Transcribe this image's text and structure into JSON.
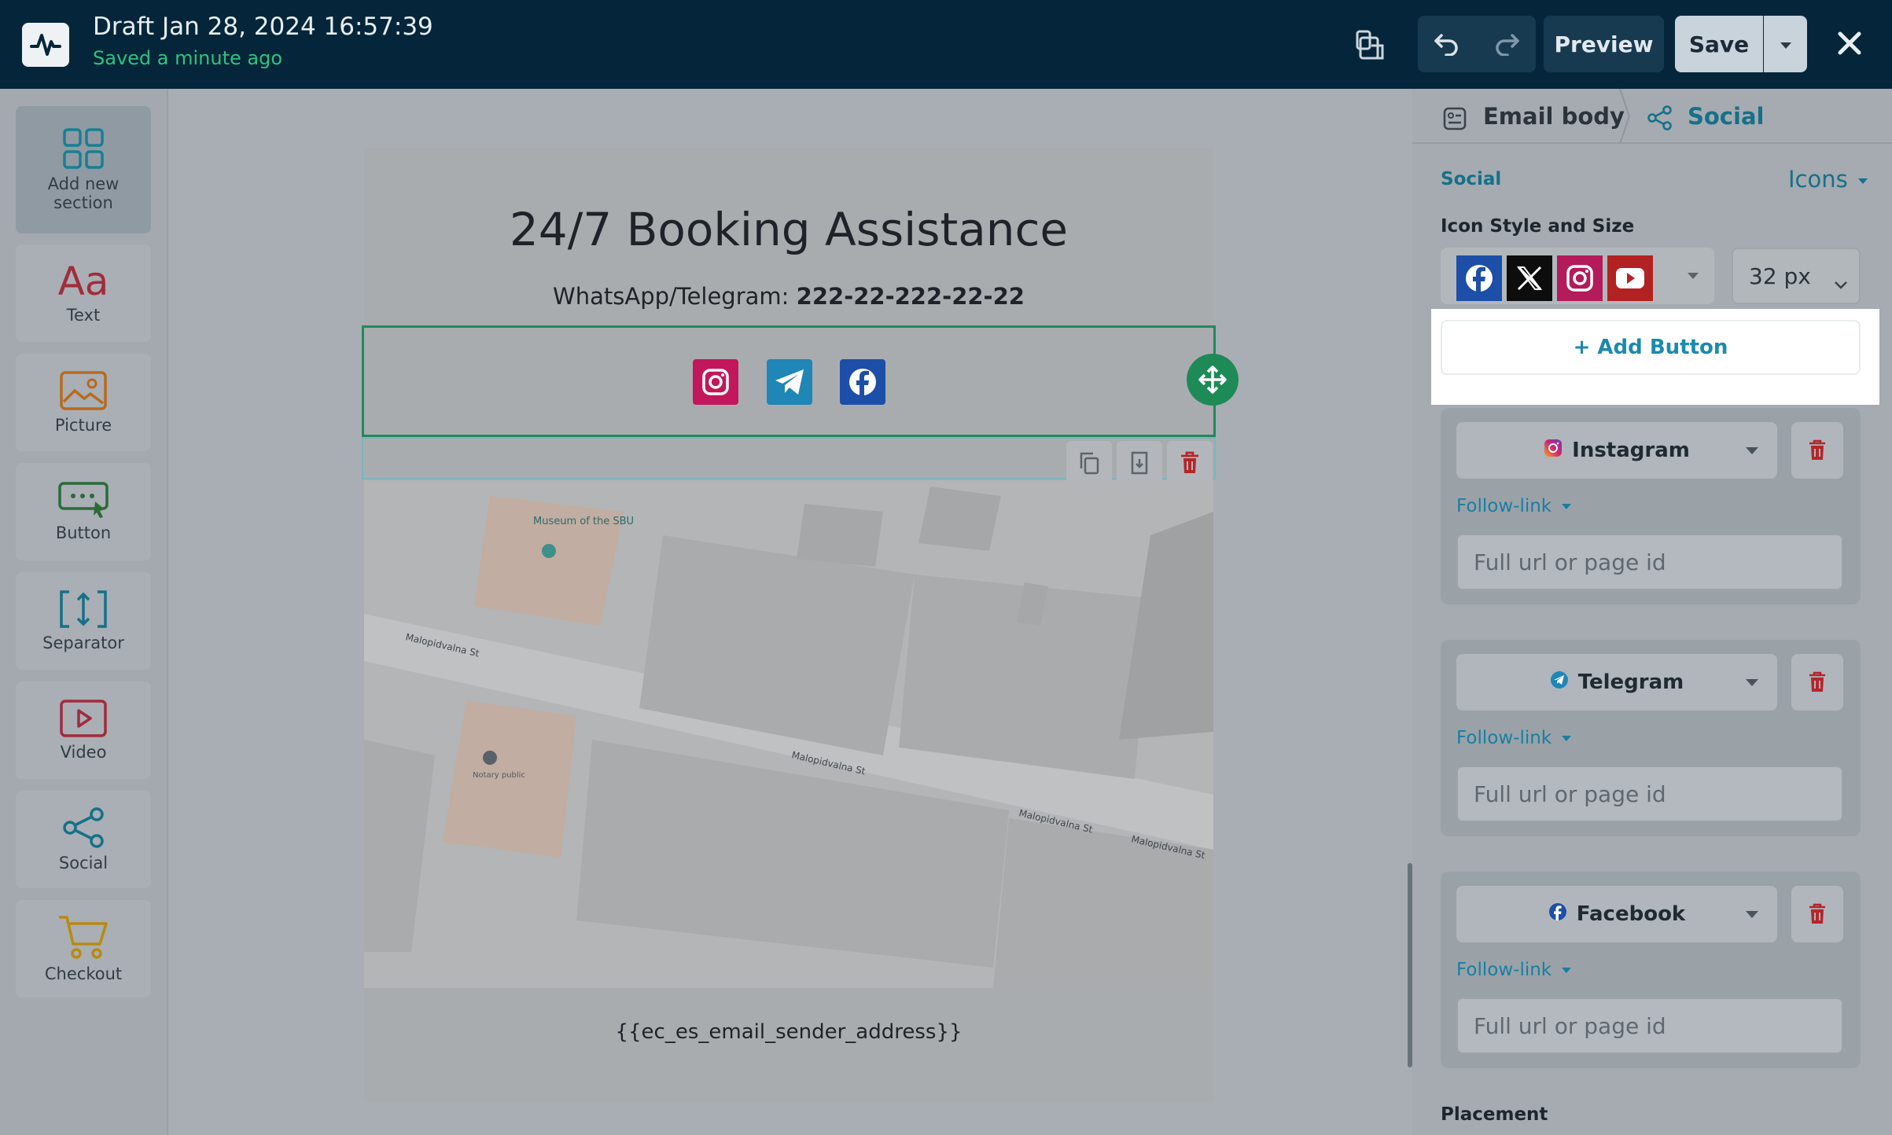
{
  "topbar": {
    "title": "Draft Jan 28, 2024 16:57:39",
    "status": "Saved a minute ago",
    "preview_label": "Preview",
    "save_label": "Save",
    "accent": "#2ec27e"
  },
  "tools": [
    {
      "label": "Add new section",
      "icon": "grid-icon"
    },
    {
      "label": "Text",
      "icon": "text-aa-icon"
    },
    {
      "label": "Picture",
      "icon": "picture-icon"
    },
    {
      "label": "Button",
      "icon": "button-icon"
    },
    {
      "label": "Separator",
      "icon": "separator-icon"
    },
    {
      "label": "Video",
      "icon": "video-icon"
    },
    {
      "label": "Social",
      "icon": "share-icon"
    },
    {
      "label": "Checkout",
      "icon": "cart-icon"
    }
  ],
  "email": {
    "headline": "24/7 Booking Assistance",
    "contact_label": "WhatsApp/Telegram:",
    "contact_value": "222-22-222-22-22",
    "social_icons": [
      "instagram-icon",
      "telegram-icon",
      "facebook-icon"
    ],
    "map_labels": {
      "museum": "Museum of the SBU",
      "notary": "Notary public",
      "street1": "Malopidvalna St",
      "street2": "Malopidvalna St",
      "street3": "Malopidvalna St",
      "street4": "Malopidvalna St"
    },
    "footer": "{{ec_es_email_sender_address}}"
  },
  "panel": {
    "breadcrumb_root": "Email body",
    "breadcrumb_current": "Social",
    "section_label": "Social",
    "mode_label": "Icons",
    "style_label": "Icon Style and Size",
    "size_value": "32 px",
    "add_button_label": "+ Add Button",
    "cards": [
      {
        "network": "Instagram",
        "follow": "Follow-link",
        "placeholder": "Full url or page id"
      },
      {
        "network": "Telegram",
        "follow": "Follow-link",
        "placeholder": "Full url or page id"
      },
      {
        "network": "Facebook",
        "follow": "Follow-link",
        "placeholder": "Full url or page id"
      }
    ],
    "placement_label": "Placement"
  }
}
